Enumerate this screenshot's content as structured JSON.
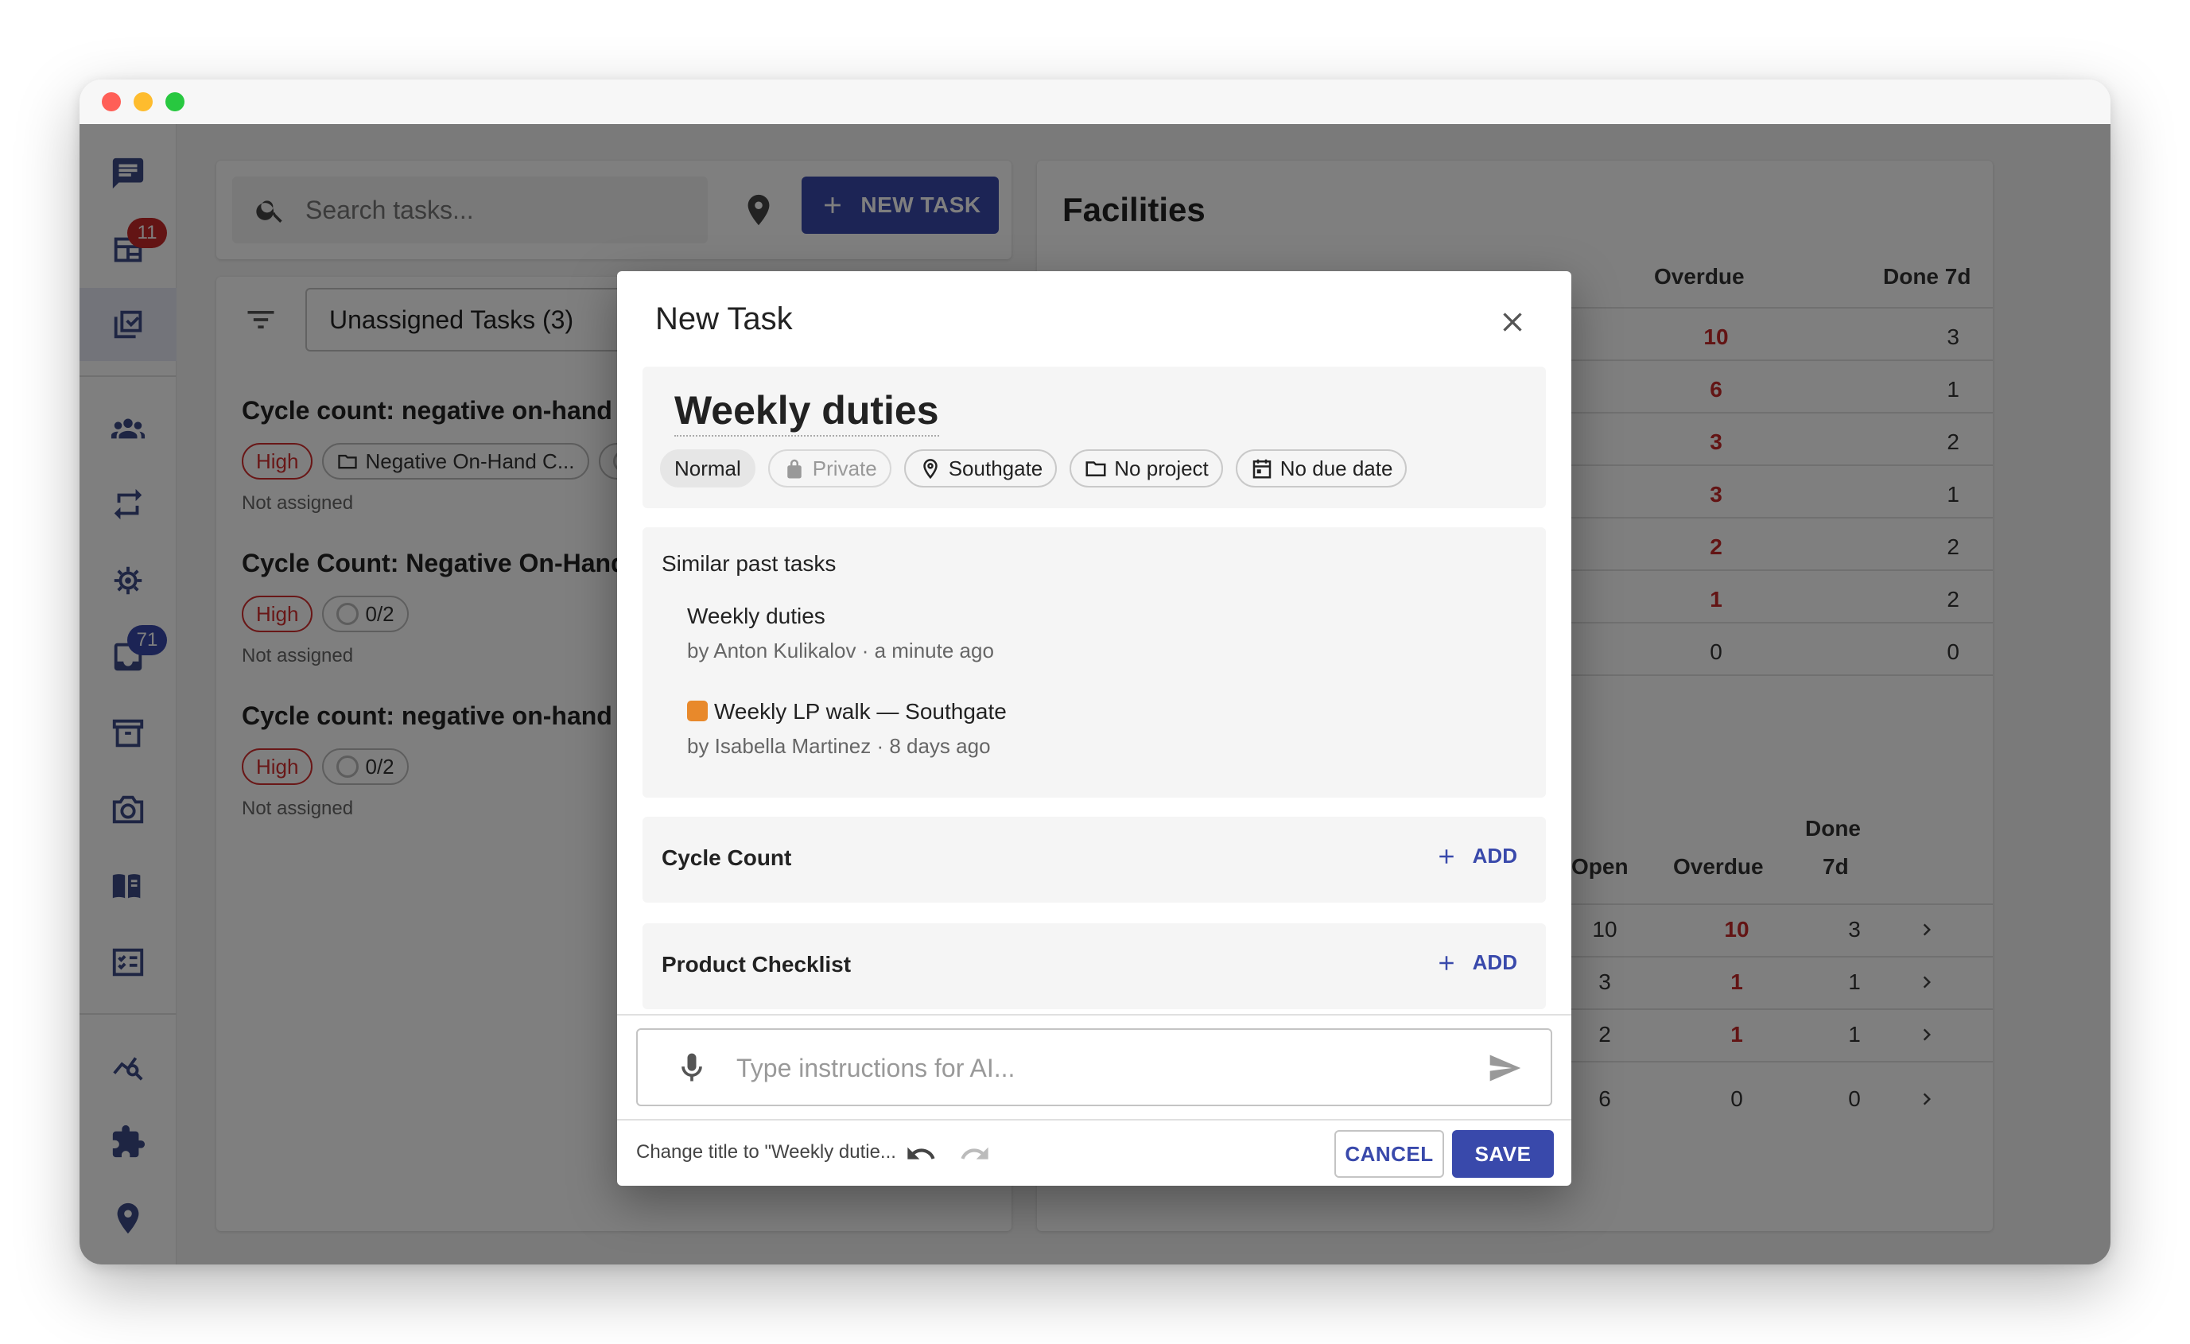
{
  "search": {
    "placeholder": "Search tasks..."
  },
  "toolbar": {
    "new_task_label": "NEW TASK"
  },
  "sidebar": {
    "badges": {
      "tasks_board": "11",
      "inbox": "71"
    },
    "items": [
      {
        "name": "chat-icon"
      },
      {
        "name": "board-icon"
      },
      {
        "name": "tasks-icon"
      },
      {
        "name": "people-icon"
      },
      {
        "name": "sync-icon"
      },
      {
        "name": "target-icon"
      },
      {
        "name": "inbox-icon"
      },
      {
        "name": "archive-icon"
      },
      {
        "name": "camera-icon"
      },
      {
        "name": "book-icon"
      },
      {
        "name": "checklist-icon"
      },
      {
        "name": "analytics-icon"
      },
      {
        "name": "extension-icon"
      },
      {
        "name": "location-icon"
      }
    ]
  },
  "task_list": {
    "group_label": "Unassigned Tasks (3)",
    "tasks": [
      {
        "title": "Cycle count: negative on-hand qu",
        "priority": "High",
        "project": "Negative On-Hand C...",
        "status": "Not assigned"
      },
      {
        "title": "Cycle Count: Negative On-Hand I",
        "priority": "High",
        "progress": "0/2",
        "status": "Not assigned"
      },
      {
        "title": "Cycle count: negative on-hand qu",
        "priority": "High",
        "progress": "0/2",
        "status": "Not assigned"
      }
    ]
  },
  "facilities": {
    "title": "Facilities",
    "table1": {
      "headers": {
        "overdue": "Overdue",
        "done7d": "Done 7d"
      },
      "rows": [
        {
          "overdue": "10",
          "done": "3"
        },
        {
          "overdue": "6",
          "done": "1"
        },
        {
          "overdue": "3",
          "done": "2"
        },
        {
          "overdue": "3",
          "done": "1"
        },
        {
          "overdue": "2",
          "done": "2"
        },
        {
          "overdue": "1",
          "done": "2"
        },
        {
          "overdue": "0",
          "done": "0"
        }
      ]
    },
    "table2": {
      "headers": {
        "open": "Open",
        "overdue": "Overdue",
        "done_line1": "Done",
        "done_line2": "7d"
      },
      "rows": [
        {
          "open": "10",
          "overdue": "10",
          "done": "3"
        },
        {
          "open": "3",
          "overdue": "1",
          "done": "1"
        },
        {
          "open": "2",
          "overdue": "1",
          "done": "1"
        },
        {
          "open": "6",
          "overdue": "0",
          "done": "0"
        }
      ]
    }
  },
  "dialog": {
    "title": "New Task",
    "task_title": "Weekly duties",
    "chips": {
      "priority": "Normal",
      "visibility": "Private",
      "location": "Southgate",
      "project": "No project",
      "due": "No due date"
    },
    "similar": {
      "heading": "Similar past tasks",
      "items": [
        {
          "title": "Weekly duties",
          "meta": "by Anton Kulikalov · a minute ago"
        },
        {
          "title": "Weekly LP walk — Southgate",
          "meta": "by Isabella Martinez · 8 days ago"
        }
      ]
    },
    "sections": [
      {
        "label": "Cycle Count",
        "action": "ADD"
      },
      {
        "label": "Product Checklist",
        "action": "ADD"
      }
    ],
    "ai_placeholder": "Type instructions for AI...",
    "footer": {
      "status": "Change title to \"Weekly dutie...",
      "cancel": "CANCEL",
      "save": "SAVE"
    }
  },
  "colors": {
    "accent": "#3949ab",
    "danger": "#c62828",
    "overlay": "rgba(0,0,0,0.5)"
  }
}
